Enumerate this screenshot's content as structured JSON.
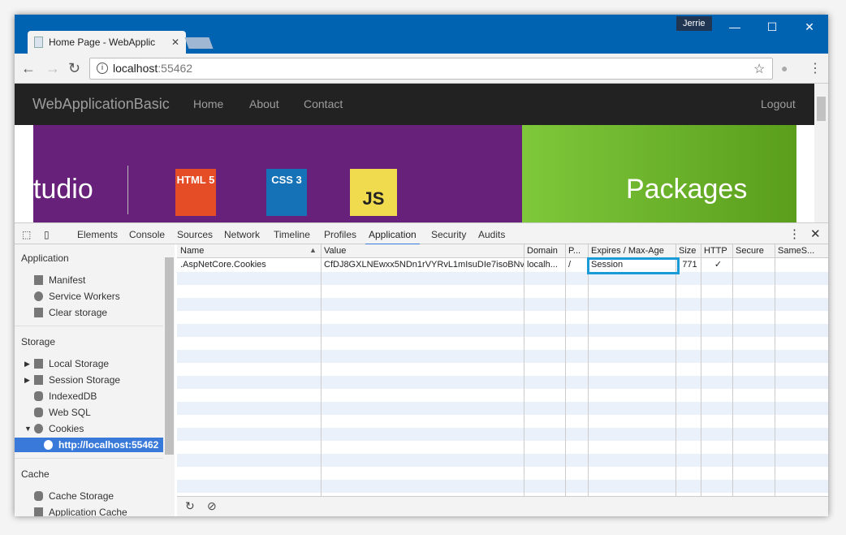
{
  "browser": {
    "user": "Jerrie",
    "tab_title": "Home Page - WebApplic",
    "url_host": "localhost",
    "url_port": ":55462"
  },
  "site": {
    "brand": "WebApplicationBasic",
    "nav": [
      "Home",
      "About",
      "Contact"
    ],
    "logout": "Logout",
    "banner_left": "tudio",
    "banner_right": "Packages",
    "logos": [
      "HTML 5",
      "CSS 3",
      "JS"
    ]
  },
  "devtools": {
    "tabs": [
      "Elements",
      "Console",
      "Sources",
      "Network",
      "Timeline",
      "Profiles",
      "Application",
      "Security",
      "Audits"
    ],
    "active_tab": "Application"
  },
  "sidebar": {
    "sections": [
      {
        "title": "Application",
        "items": [
          "Manifest",
          "Service Workers",
          "Clear storage"
        ]
      },
      {
        "title": "Storage",
        "items": [
          "Local Storage",
          "Session Storage",
          "IndexedDB",
          "Web SQL",
          "Cookies",
          "http://localhost:55462"
        ]
      },
      {
        "title": "Cache",
        "items": [
          "Cache Storage",
          "Application Cache"
        ]
      }
    ]
  },
  "table": {
    "columns": [
      "Name",
      "Value",
      "Domain",
      "P...",
      "Expires / Max-Age",
      "Size",
      "HTTP",
      "Secure",
      "SameS..."
    ],
    "rows": [
      {
        "name": ".AspNetCore.Cookies",
        "value": "CfDJ8GXLNEwxx5NDn1rVYRvL1mIsuDIe7isoBNv...",
        "domain": "localh...",
        "path": "/",
        "expires": "Session",
        "size": "771",
        "http": "✓",
        "secure": "",
        "samesite": ""
      }
    ]
  },
  "colors": {
    "titlebar": "#0063b1",
    "selection": "#3879d9",
    "edit_highlight": "#1a9ad6"
  }
}
